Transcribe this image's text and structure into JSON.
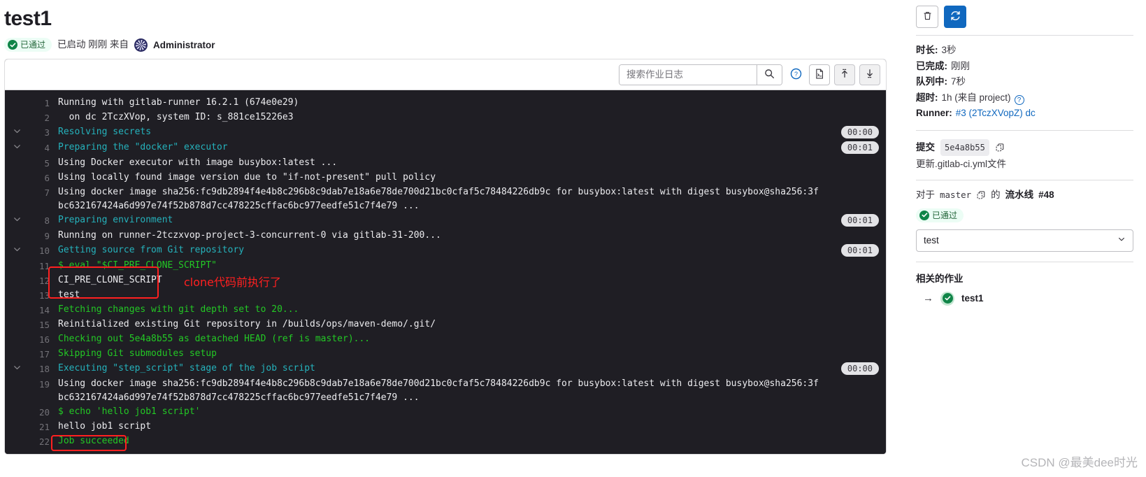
{
  "header": {
    "job_title": "test1",
    "status_badge": "已通过",
    "status_icon": "check-circle-icon",
    "started_text": "已启动 刚刚 来自",
    "author": "Administrator",
    "avatar_icon": "identicon-avatar"
  },
  "toolbar": {
    "search_placeholder": "搜索作业日志",
    "search_value": "",
    "search_icon": "search-icon",
    "help_icon": "question-circle-icon",
    "raw_icon": "raw-log-file-icon",
    "scroll_top_icon": "scroll-to-top-icon",
    "scroll_bottom_icon": "scroll-to-bottom-icon"
  },
  "log": {
    "lines": [
      {
        "n": "1",
        "collapsible": false,
        "kind": "plain",
        "text": "Running with gitlab-runner 16.2.1 (674e0e29)",
        "time": ""
      },
      {
        "n": "2",
        "collapsible": false,
        "kind": "plain",
        "text": "  on dc 2TczXVop, system ID: s_881ce15226e3",
        "time": ""
      },
      {
        "n": "3",
        "collapsible": true,
        "kind": "section",
        "text": "Resolving secrets",
        "time": "00:00"
      },
      {
        "n": "4",
        "collapsible": true,
        "kind": "section",
        "text": "Preparing the \"docker\" executor",
        "time": "00:01"
      },
      {
        "n": "5",
        "collapsible": false,
        "kind": "plain",
        "text": "Using Docker executor with image busybox:latest ...",
        "time": ""
      },
      {
        "n": "6",
        "collapsible": false,
        "kind": "plain",
        "text": "Using locally found image version due to \"if-not-present\" pull policy",
        "time": ""
      },
      {
        "n": "7",
        "collapsible": false,
        "kind": "plain",
        "text": "Using docker image sha256:fc9db2894f4e4b8c296b8c9dab7e18a6e78de700d21bc0cfaf5c78484226db9c for busybox:latest with digest busybox@sha256:3fbc632167424a6d997e74f52b878d7cc478225cffac6bc977eedfe51c7f4e79 ...",
        "time": ""
      },
      {
        "n": "8",
        "collapsible": true,
        "kind": "section",
        "text": "Preparing environment",
        "time": "00:01"
      },
      {
        "n": "9",
        "collapsible": false,
        "kind": "plain",
        "text": "Running on runner-2tczxvop-project-3-concurrent-0 via gitlab-31-200...",
        "time": ""
      },
      {
        "n": "10",
        "collapsible": true,
        "kind": "section",
        "text": "Getting source from Git repository",
        "time": "00:01"
      },
      {
        "n": "11",
        "collapsible": false,
        "kind": "cmd",
        "text": "$ eval \"$CI_PRE_CLONE_SCRIPT\"",
        "time": ""
      },
      {
        "n": "12",
        "collapsible": false,
        "kind": "plain",
        "text": "CI_PRE_CLONE_SCRIPT",
        "time": ""
      },
      {
        "n": "13",
        "collapsible": false,
        "kind": "plain",
        "text": "test",
        "time": ""
      },
      {
        "n": "14",
        "collapsible": false,
        "kind": "green",
        "text": "Fetching changes with git depth set to 20...",
        "time": ""
      },
      {
        "n": "15",
        "collapsible": false,
        "kind": "plain",
        "text": "Reinitialized existing Git repository in /builds/ops/maven-demo/.git/",
        "time": ""
      },
      {
        "n": "16",
        "collapsible": false,
        "kind": "green",
        "text": "Checking out 5e4a8b55 as detached HEAD (ref is master)...",
        "time": ""
      },
      {
        "n": "17",
        "collapsible": false,
        "kind": "green",
        "text": "Skipping Git submodules setup",
        "time": ""
      },
      {
        "n": "18",
        "collapsible": true,
        "kind": "section",
        "text": "Executing \"step_script\" stage of the job script",
        "time": "00:00"
      },
      {
        "n": "19",
        "collapsible": false,
        "kind": "plain",
        "text": "Using docker image sha256:fc9db2894f4e4b8c296b8c9dab7e18a6e78de700d21bc0cfaf5c78484226db9c for busybox:latest with digest busybox@sha256:3fbc632167424a6d997e74f52b878d7cc478225cffac6bc977eedfe51c7f4e79 ...",
        "time": ""
      },
      {
        "n": "20",
        "collapsible": false,
        "kind": "cmd",
        "text": "$ echo 'hello job1 script'",
        "time": ""
      },
      {
        "n": "21",
        "collapsible": false,
        "kind": "plain",
        "text": "hello job1 script",
        "time": ""
      },
      {
        "n": "22",
        "collapsible": false,
        "kind": "green",
        "text": "Job succeeded",
        "time": ""
      }
    ]
  },
  "annotations": {
    "note_text": "clone代码前执行了",
    "color": "#ff2020"
  },
  "sidebar": {
    "erase_icon": "trash-icon",
    "retry_icon": "retry-refresh-icon",
    "details": [
      {
        "key": "时长:",
        "value": "3秒",
        "link": "",
        "help": false
      },
      {
        "key": "已完成:",
        "value": "刚刚",
        "link": "",
        "help": false
      },
      {
        "key": "队列中:",
        "value": "7秒",
        "link": "",
        "help": false
      },
      {
        "key": "超时:",
        "value": "1h (来自 project)",
        "link": "",
        "help": true
      },
      {
        "key": "Runner:",
        "value": "",
        "link": "#3 (2TczXVopZ) dc",
        "help": false
      }
    ],
    "commit": {
      "label": "提交",
      "sha": "5e4a8b55",
      "copy_icon": "copy-icon",
      "title": "更新.gitlab-ci.yml文件"
    },
    "pipeline": {
      "prefix": "对于",
      "ref": "master",
      "copy_icon": "copy-icon",
      "middle": "的",
      "label": "流水线",
      "number": "#48",
      "status_badge": "已通过"
    },
    "stage_select": {
      "value": "test",
      "chevron_icon": "chevron-down-icon"
    },
    "related": {
      "title": "相关的作业",
      "jobs": [
        {
          "arrow_icon": "arrow-right-icon",
          "status_icon": "check-circle-icon",
          "name": "test1"
        }
      ]
    }
  },
  "watermark": "CSDN @最美dee时光"
}
